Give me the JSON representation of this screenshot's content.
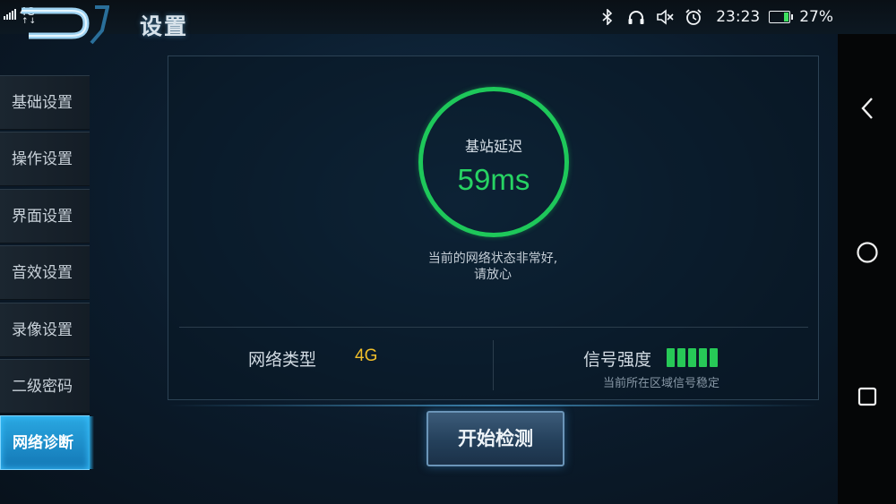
{
  "status_bar": {
    "network": "4G",
    "network_arrows": "↑↓",
    "time": "23:23",
    "battery": "27%",
    "battery_level": 0.27,
    "icons": [
      "bluetooth-icon",
      "headset-icon",
      "mute-icon",
      "alarm-icon",
      "battery-icon"
    ]
  },
  "header": {
    "title": "设置"
  },
  "sidebar": {
    "items": [
      {
        "label": "基础设置",
        "active": false
      },
      {
        "label": "操作设置",
        "active": false
      },
      {
        "label": "界面设置",
        "active": false
      },
      {
        "label": "音效设置",
        "active": false
      },
      {
        "label": "录像设置",
        "active": false
      },
      {
        "label": "二级密码",
        "active": false
      },
      {
        "label": "网络诊断",
        "active": true
      }
    ]
  },
  "diagnosis": {
    "latency_label": "基站延迟",
    "latency_value": "59ms",
    "status_line1": "当前的网络状态非常好,",
    "status_line2": "请放心",
    "network_type_label": "网络类型",
    "network_type_value": "4G",
    "signal_label": "信号强度",
    "signal_bars": 5,
    "signal_note": "当前所在区域信号稳定"
  },
  "actions": {
    "start_button": "开始检测"
  },
  "colors": {
    "accent_green": "#27d463",
    "value_yellow": "#f1bf2a",
    "active_tab": "#2aa8e2"
  }
}
